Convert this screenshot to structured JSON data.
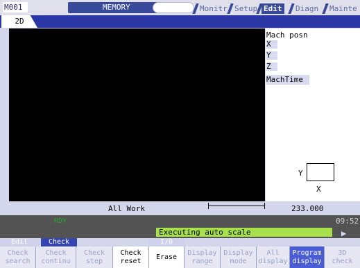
{
  "header": {
    "machine": "M001",
    "mode": "MEMORY",
    "menu": [
      "Monitr",
      "Setup",
      "Edit",
      "Diagn",
      "Mainte"
    ],
    "active_menu": "Edit"
  },
  "screen_tab": "2D",
  "position": {
    "title": "Mach posn",
    "axes": [
      "X",
      "Y",
      "Z"
    ],
    "time_label": "MachTime"
  },
  "view": {
    "axis_y": "Y",
    "axis_x": "X",
    "label": "All Work",
    "scale_value": "233.000"
  },
  "status": {
    "ready": "RDY",
    "clock": "09:52",
    "message": "Executing auto scale"
  },
  "groups": [
    {
      "label": "Edit",
      "style": "dim"
    },
    {
      "label": "Check",
      "style": "active"
    },
    {
      "label": "I/O",
      "style": "dim"
    }
  ],
  "softkeys": [
    {
      "label": "Check\nsearch",
      "style": "dim"
    },
    {
      "label": "Check\ncontinu",
      "style": "dim"
    },
    {
      "label": "Check\nstep",
      "style": "dim"
    },
    {
      "label": "Check\nreset",
      "style": "active"
    },
    {
      "label": "Erase",
      "style": "active"
    },
    {
      "label": "Display\nrange",
      "style": "dim"
    },
    {
      "label": "Display\nmode",
      "style": "dim"
    },
    {
      "label": "All\ndisplay",
      "style": "dim"
    },
    {
      "label": "Program\ndisplay",
      "style": "hl"
    },
    {
      "label": "3D\ncheck",
      "style": "dim"
    }
  ]
}
